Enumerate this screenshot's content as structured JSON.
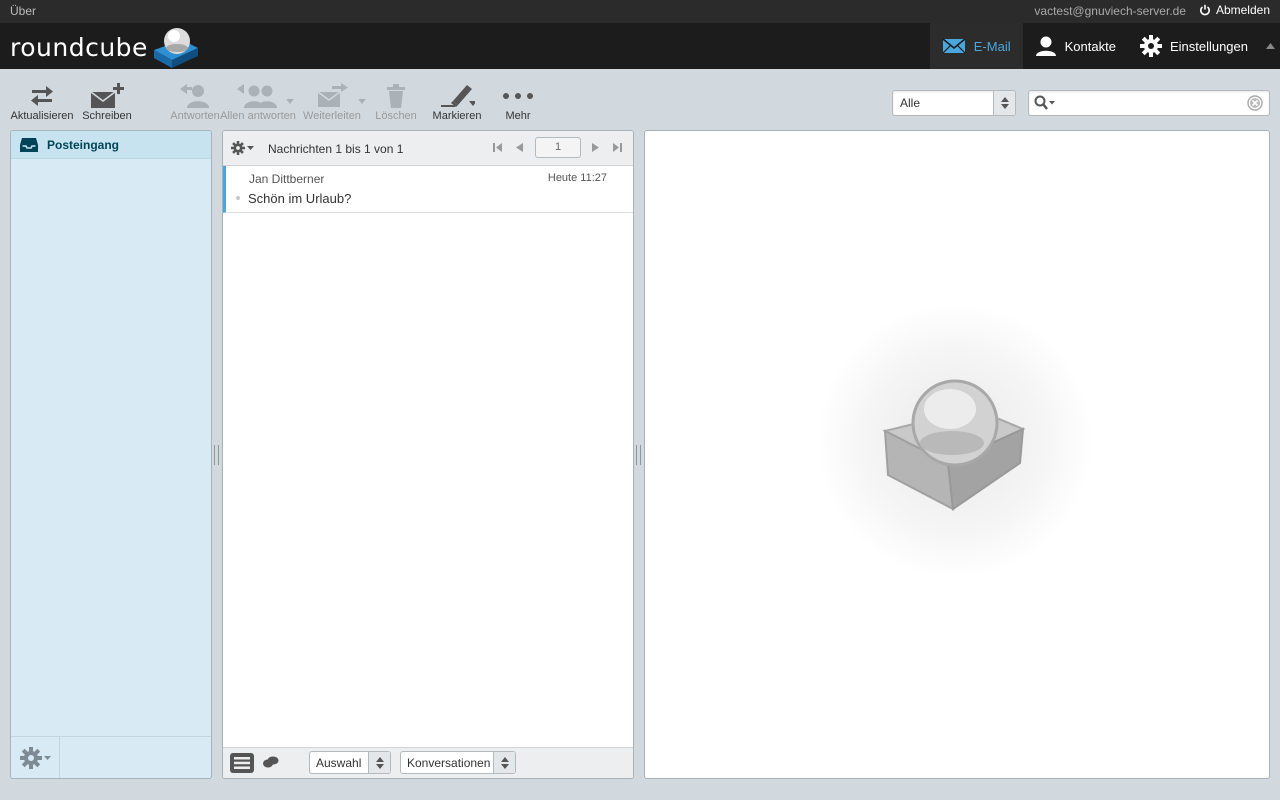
{
  "topline": {
    "about": "Über",
    "user": "vactest@gnuviech-server.de",
    "logout": "Abmelden"
  },
  "logo": {
    "text": "roundcube"
  },
  "taskbar": [
    {
      "label": "E-Mail",
      "icon": "envelope-icon",
      "active": true
    },
    {
      "label": "Kontakte",
      "icon": "person-icon",
      "active": false
    },
    {
      "label": "Einstellungen",
      "icon": "gear-icon",
      "active": false
    }
  ],
  "toolbar": {
    "refresh": "Aktualisieren",
    "compose": "Schreiben",
    "reply": "Antworten",
    "reply_all": "Allen antworten",
    "forward": "Weiterleiten",
    "delete": "Löschen",
    "mark": "Markieren",
    "more": "Mehr"
  },
  "filter": {
    "selected": "Alle"
  },
  "search": {
    "value": ""
  },
  "folders": [
    {
      "name": "Posteingang",
      "icon": "inbox-icon",
      "selected": true
    }
  ],
  "messagelist": {
    "count_text": "Nachrichten 1 bis 1 von 1",
    "page": "1",
    "messages": [
      {
        "from": "Jan Dittberner",
        "date": "Heute 11:27",
        "subject": "Schön im Urlaub?"
      }
    ],
    "footer": {
      "select": "Auswahl",
      "threads": "Konversationen"
    }
  },
  "colors": {
    "accent": "#4aa7dd",
    "header": "#1c1c1c",
    "topline": "#2b2b2b",
    "background": "#d1d9df",
    "folder_pane": "#d8ebf4"
  }
}
